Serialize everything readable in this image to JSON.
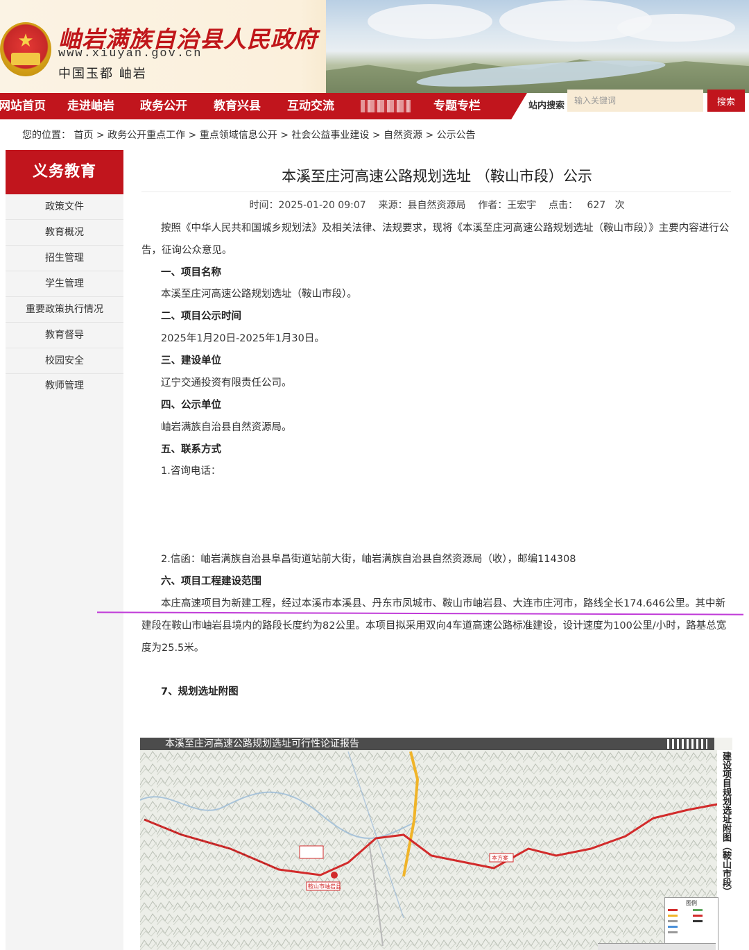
{
  "header": {
    "site_title": "岫岩满族自治县人民政府",
    "site_url": "www.xiuyan.gov.cn",
    "slogan": "中国玉都 岫岩"
  },
  "nav": {
    "items": [
      "网站首页",
      "走进岫岩",
      "政务公开",
      "教育兴县",
      "互动交流",
      "专题专栏"
    ],
    "search_label": "站内搜索",
    "search_placeholder": "输入关键词",
    "search_button": "搜索"
  },
  "breadcrumb": {
    "prefix": "您的位置：",
    "items": [
      "首页",
      "政务公开重点工作",
      "重点领域信息公开",
      "社会公益事业建设",
      "自然资源",
      "公示公告"
    ],
    "separator": ">"
  },
  "sidebar": {
    "title": "义务教育",
    "items": [
      "政策文件",
      "教育概况",
      "招生管理",
      "学生管理",
      "重要政策执行情况",
      "教育督导",
      "校园安全",
      "教师管理"
    ]
  },
  "article": {
    "title": "本溪至庄河高速公路规划选址 （鞍山市段）公示",
    "meta": "时间：2025-01-20 09:07    来源：县自然资源局    作者：王宏宇    点击：   627   次",
    "intro": "按照《中华人民共和国城乡规划法》及相关法律、法规要求，现将《本溪至庄河高速公路规划选址（鞍山市段）》主要内容进行公告，征询公众意见。",
    "s1_title": "一、项目名称",
    "s1_body": "本溪至庄河高速公路规划选址（鞍山市段）。",
    "s2_title": "二、项目公示时间",
    "s2_body": "2025年1月20日-2025年1月30日。",
    "s3_title": "三、建设单位",
    "s3_body": "辽宁交通投资有限责任公司。",
    "s4_title": "四、公示单位",
    "s4_body": "岫岩满族自治县自然资源局。",
    "s5_title": "五、联系方式",
    "s5_phone": "1.咨询电话：",
    "s5_mail": "2.信函：岫岩满族自治县阜昌街道站前大街，岫岩满族自治县自然资源局（收），邮编114308",
    "s6_title": "六、项目工程建设范围",
    "s6_body": "本庄高速项目为新建工程，经过本溪市本溪县、丹东市凤城市、鞍山市岫岩县、大连市庄河市，路线全长174.646公里。其中新建段在鞍山市岫岩县境内的路段长度约为82公里。本项目拟采用双向4车道高速公路标准建设，设计速度为100公里/小时，路基总宽度为25.5米。",
    "s7_title": "7、规划选址附图"
  },
  "map": {
    "title": "本溪至庄河高速公路规划选址可行性论证报告",
    "side_title": "建设项目规划选址附图（鞍山市段）",
    "legend_title": "图例",
    "labels": [
      "鞍山市岫岩县",
      "本方案"
    ],
    "route_color": "#d22b2b"
  },
  "colors": {
    "brand_red": "#c1151d",
    "search_bg": "#f8ebd5",
    "annotation_line": "#c03bd8"
  }
}
